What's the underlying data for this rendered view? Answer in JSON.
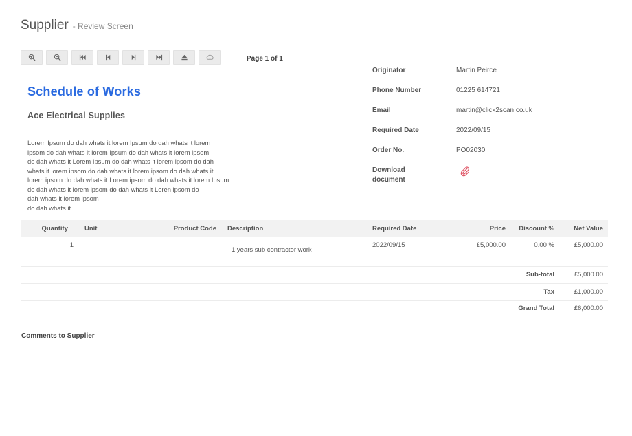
{
  "header": {
    "title": "Supplier",
    "subtitle": "- Review Screen"
  },
  "toolbar": {
    "buttons": [
      {
        "name": "zoom-in-button",
        "icon": "zoom-in-icon"
      },
      {
        "name": "zoom-out-button",
        "icon": "zoom-out-icon"
      },
      {
        "name": "first-page-button",
        "icon": "first-page-icon"
      },
      {
        "name": "prev-page-button",
        "icon": "prev-page-icon"
      },
      {
        "name": "next-page-button",
        "icon": "next-page-icon"
      },
      {
        "name": "last-page-button",
        "icon": "last-page-icon"
      },
      {
        "name": "eject-button",
        "icon": "eject-icon"
      },
      {
        "name": "cloud-download-button",
        "icon": "cloud-download-icon"
      }
    ],
    "page_indicator": "Page 1 of 1"
  },
  "document": {
    "title": "Schedule of Works",
    "supplier_name": "Ace Electrical Supplies",
    "body_lines": [
      "Lorem Ipsum do dah whats it lorem Ipsum do dah whats it lorem",
      "ipsom do dah whats it  lorem Ipsum do dah whats it lorem ipsom",
      "do dah whats it Lorem Ipsum do dah whats it lorem ipsom do dah",
      "whats it lorem ipsom do dah whats it  lorem ipsom do dah whats it",
      " lorem ipsom do dah whats it Lorem ipsom do dah whats it lorem Ipsum",
      "do dah whats it lorem ipsom do dah whats it  Loren ipsom do",
      "dah whats it lorem ipsom",
      "do dah whats it"
    ],
    "title_color": "#2a6ae0"
  },
  "info": {
    "originator": {
      "label": "Originator",
      "value": "Martin Peirce"
    },
    "phone": {
      "label": "Phone Number",
      "value": "01225 614721"
    },
    "email": {
      "label": "Email",
      "value": "martin@click2scan.co.uk"
    },
    "required_date": {
      "label": "Required Date",
      "value": "2022/09/15"
    },
    "order_no": {
      "label": "Order No.",
      "value": "PO02030"
    },
    "download": {
      "label_line1": "Download",
      "label_line2": "document",
      "icon": "paperclip-icon",
      "icon_color": "#e05a6a"
    }
  },
  "table": {
    "headers": {
      "quantity": "Quantity",
      "unit": "Unit",
      "product_code": "Product Code",
      "description": "Description",
      "required_date": "Required Date",
      "price": "Price",
      "discount": "Discount %",
      "net_value": "Net Value"
    },
    "rows": [
      {
        "quantity": "1",
        "unit": "",
        "product_code": "",
        "description": "1 years sub contractor work",
        "required_date": "2022/09/15",
        "price": "£5,000.00",
        "discount": "0.00 %",
        "net_value": "£5,000.00"
      }
    ]
  },
  "totals": {
    "subtotal": {
      "label": "Sub-total",
      "value": "£5,000.00"
    },
    "tax": {
      "label": "Tax",
      "value": "£1,000.00"
    },
    "grand_total": {
      "label": "Grand Total",
      "value": "£6,000.00"
    }
  },
  "comments": {
    "label": "Comments to Supplier"
  }
}
